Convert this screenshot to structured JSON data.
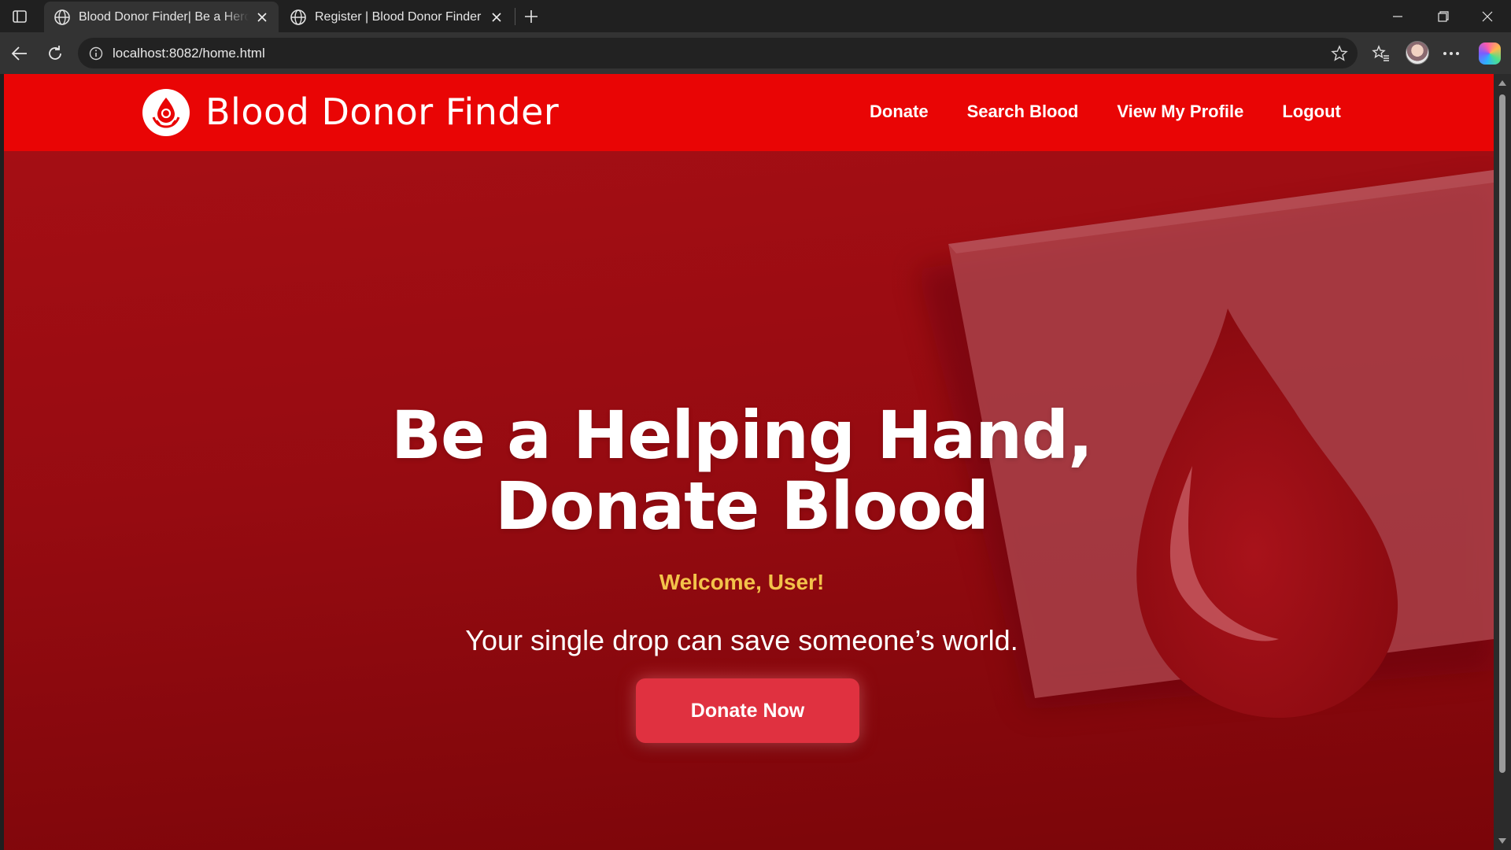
{
  "browser": {
    "tabs": [
      {
        "title": "Blood Donor Finder| Be a Hero, Donate Blood",
        "active": true
      },
      {
        "title": "Register | Blood Donor Finder",
        "active": false
      }
    ],
    "url": "localhost:8082/home.html"
  },
  "navbar": {
    "brand": "Blood Donor Finder",
    "links": [
      "Donate",
      "Search Blood",
      "View My Profile",
      "Logout"
    ],
    "color": "#e90505"
  },
  "hero": {
    "headline_line1": "Be a Helping Hand,",
    "headline_line2": "Donate Blood",
    "welcome": "Welcome, User!",
    "tagline": "Your single drop can save someone’s world.",
    "cta": "Donate Now",
    "accent": "#f3c34a",
    "cta_color": "#e03140"
  }
}
